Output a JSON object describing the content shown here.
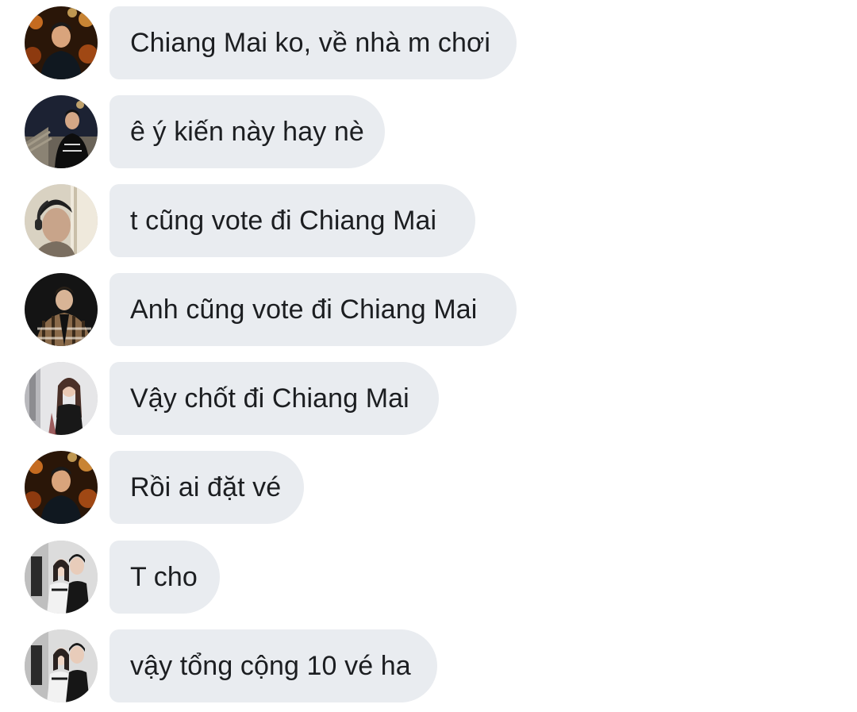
{
  "messages": [
    {
      "sender_avatar": "avatar-photo-man-orange-lights",
      "text": "Chiang Mai ko, về nhà m chơi"
    },
    {
      "sender_avatar": "avatar-photo-man-stairs-night",
      "text": "ê ý kiến này hay nè"
    },
    {
      "sender_avatar": "avatar-photo-man-headphones",
      "text": "t cũng vote đi Chiang Mai"
    },
    {
      "sender_avatar": "avatar-photo-man-plaid-shirt",
      "text": "Anh cũng vote đi Chiang Mai"
    },
    {
      "sender_avatar": "avatar-photo-woman-long-hair",
      "text": "Vậy chốt đi Chiang Mai"
    },
    {
      "sender_avatar": "avatar-photo-man-orange-lights",
      "text": "Rồi ai đặt vé"
    },
    {
      "sender_avatar": "avatar-photo-two-people-mirror",
      "text": "T cho"
    },
    {
      "sender_avatar": "avatar-photo-two-people-mirror",
      "text": "vậy tổng cộng 10 vé ha"
    }
  ],
  "colors": {
    "bubble_background": "#e9ecf0",
    "message_text": "#1c1e21",
    "page_background": "#ffffff"
  }
}
